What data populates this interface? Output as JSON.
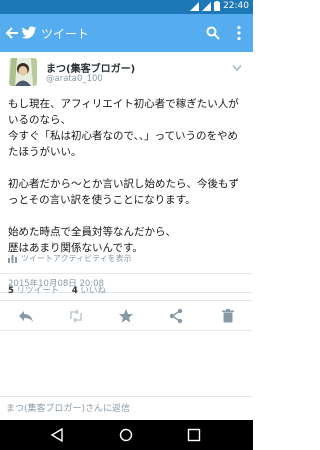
{
  "status_bar": {
    "time": "22:40"
  },
  "app_bar": {
    "title": "ツイート"
  },
  "tweet": {
    "display_name": "まつ(集客ブロガー)",
    "handle": "@arata0_100",
    "text": "もし現在、アフィリエイト初心者で稼ぎたい人がいるのなら、\n今すぐ「私は初心者なので、、」っていうのをやめたほうがいい。\n\n初心者だから～とか言い訳し始めたら、今後もずっとその言い訳を使うことになります。\n\n始めた時点で全員対等なんだから、\n歴はあまり関係ないんです。",
    "date": "2015年10月08日 20:08",
    "activity_label": "ツイートアクティビティを表示",
    "retweets_count": "5",
    "retweets_label": "リツイート",
    "likes_count": "4",
    "likes_label": "いいね",
    "icons": [
      "reply-icon",
      "retweet-icon",
      "star-icon",
      "share-icon",
      "trash-icon"
    ]
  },
  "reply": {
    "placeholder": "まつ(集客ブロガー)さんに返信"
  },
  "colors": {
    "accent": "#55acee",
    "status_bar": "#1e78b8"
  }
}
